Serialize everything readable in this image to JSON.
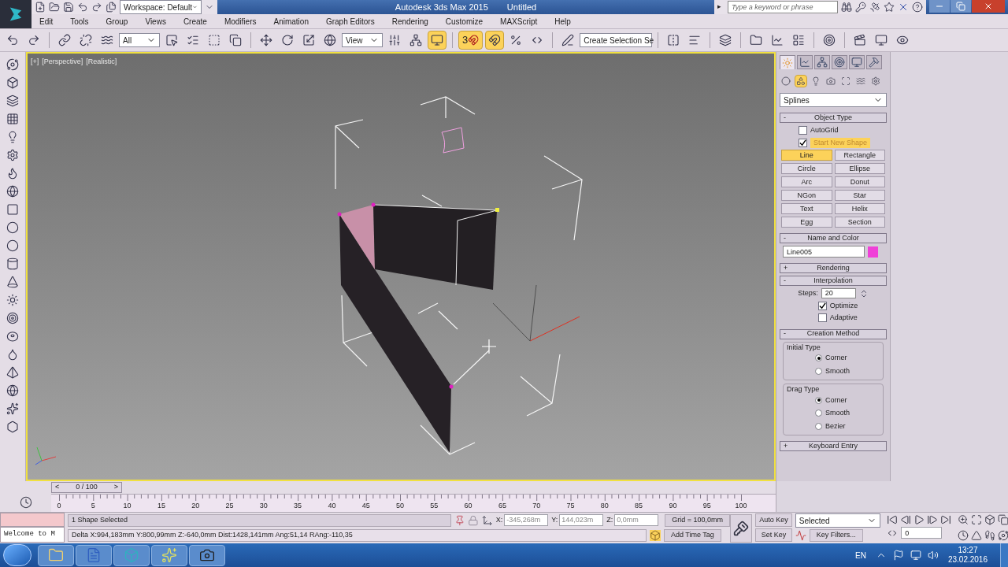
{
  "title_bar": {
    "workspace": "Workspace: Default",
    "app_title": "Autodesk 3ds Max 2015",
    "document": "Untitled",
    "search_arrow": "▸",
    "search_placeholder": "Type a keyword or phrase"
  },
  "menu": [
    "Edit",
    "Tools",
    "Group",
    "Views",
    "Create",
    "Modifiers",
    "Animation",
    "Graph Editors",
    "Rendering",
    "Customize",
    "MAXScript",
    "Help"
  ],
  "toolbar": {
    "selection_filter": "All",
    "reference_coord": "View",
    "named_selection": "Create Selection Se",
    "keyboard_override_on": true,
    "snaps_dimension": "3",
    "snaps_on": true,
    "angle_snap_on": true
  },
  "viewport": {
    "labels": [
      "[+]",
      "[Perspective]",
      "[Realistic]"
    ],
    "active": true
  },
  "command_panel": {
    "tabs": [
      {
        "selected": true
      },
      {
        "selected": false
      },
      {
        "selected": false
      },
      {
        "selected": false
      },
      {
        "selected": false
      },
      {
        "selected": false
      }
    ],
    "categories": [
      {
        "selected": false
      },
      {
        "selected": true
      },
      {
        "selected": false
      },
      {
        "selected": false
      },
      {
        "selected": false
      },
      {
        "selected": false
      },
      {
        "selected": false
      }
    ],
    "category_type": "Splines",
    "object_type": {
      "sign": "-",
      "title": "Object Type",
      "autogrid": {
        "label": "AutoGrid",
        "checked": false
      },
      "start_new_shape": {
        "label": "Start New Shape",
        "checked": true
      },
      "buttons": [
        {
          "label": "Line",
          "selected": true
        },
        {
          "label": "Rectangle",
          "selected": false
        },
        {
          "label": "Circle",
          "selected": false
        },
        {
          "label": "Ellipse",
          "selected": false
        },
        {
          "label": "Arc",
          "selected": false
        },
        {
          "label": "Donut",
          "selected": false
        },
        {
          "label": "NGon",
          "selected": false
        },
        {
          "label": "Star",
          "selected": false
        },
        {
          "label": "Text",
          "selected": false
        },
        {
          "label": "Helix",
          "selected": false
        },
        {
          "label": "Egg",
          "selected": false
        },
        {
          "label": "Section",
          "selected": false
        }
      ]
    },
    "name_and_color": {
      "sign": "-",
      "title": "Name and Color",
      "name": "Line005",
      "color": "#f040d8"
    },
    "rendering": {
      "sign": "+",
      "title": "Rendering"
    },
    "interpolation": {
      "sign": "-",
      "title": "Interpolation",
      "steps_label": "Steps:",
      "steps": "20",
      "optimize": {
        "label": "Optimize",
        "checked": true
      },
      "adaptive": {
        "label": "Adaptive",
        "checked": false
      }
    },
    "creation_method": {
      "sign": "-",
      "title": "Creation Method",
      "groups": [
        {
          "title": "Initial Type",
          "options": [
            {
              "label": "Corner",
              "selected": true
            },
            {
              "label": "Smooth",
              "selected": false
            }
          ]
        },
        {
          "title": "Drag Type",
          "options": [
            {
              "label": "Corner",
              "selected": true
            },
            {
              "label": "Smooth",
              "selected": false
            },
            {
              "label": "Bezier",
              "selected": false
            }
          ]
        }
      ]
    },
    "keyboard_entry": {
      "sign": "+",
      "title": "Keyboard Entry"
    }
  },
  "time_slider": {
    "prev": "<",
    "frame": "0 / 100",
    "next": ">",
    "level": 0
  },
  "ruler_labels": [
    "0",
    "5",
    "10",
    "15",
    "20",
    "25",
    "30",
    "35",
    "40",
    "45",
    "50",
    "55",
    "60",
    "65",
    "70",
    "75",
    "80",
    "85",
    "90",
    "95",
    "100"
  ],
  "status": {
    "listener_output": "Welcome to M",
    "selection": "1 Shape Selected",
    "prompt": "Delta X:994,183mm  Y:800,99mm  Z:-640,0mm  Dist:1428,141mm Ang:51,14 RAng:-110,35",
    "coords": [
      {
        "axis": "X:",
        "value": "-345,268m"
      },
      {
        "axis": "Y:",
        "value": "144,023m"
      },
      {
        "axis": "Z:",
        "value": "0,0mm"
      }
    ],
    "grid": "Grid = 100,0mm",
    "add_time_tag": "Add Time Tag",
    "auto_key": "Auto Key",
    "set_key": "Set Key",
    "key_mode": "Selected",
    "key_filters": "Key Filters...",
    "current_frame": "0"
  },
  "taskbar": {
    "language": "EN",
    "time": "13:27",
    "date": "23.02.2016"
  }
}
